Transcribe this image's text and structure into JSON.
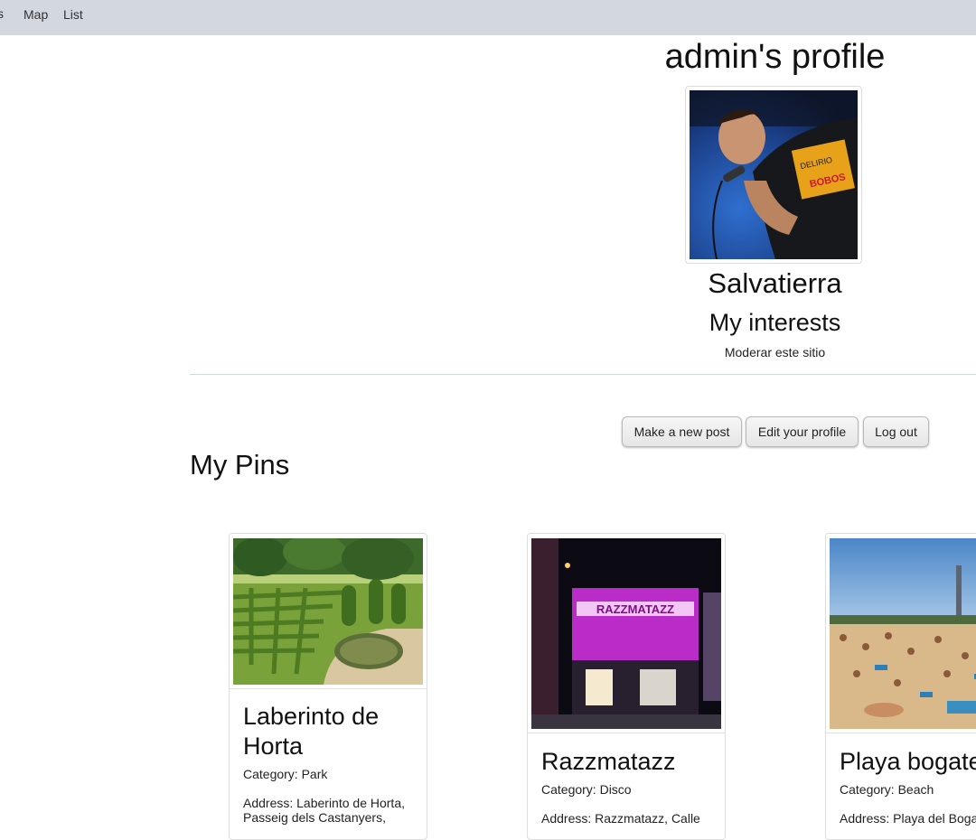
{
  "navbar": {
    "brand_fragment": "s",
    "links": [
      "Map",
      "List"
    ]
  },
  "profile": {
    "title": "admin's profile",
    "name": "Salvatierra",
    "interests_heading": "My interests",
    "interests_text": "Moderar este sitio"
  },
  "actions": {
    "new_post": "Make a new post",
    "edit_profile": "Edit your profile",
    "logout": "Log out"
  },
  "pins_heading": "My Pins",
  "pins": [
    {
      "title": "Laberinto de Horta",
      "category": "Category: Park",
      "address": "Address: Laberinto de Horta, Passeig dels Castanyers,"
    },
    {
      "title": "Razzmatazz",
      "category": "Category: Disco",
      "address": "Address: Razzmatazz, Calle",
      "image_sign": "RAZZMATAZZ"
    },
    {
      "title": "Playa bogatell",
      "category": "Category: Beach",
      "address": "Address: Playa del Bogatell"
    }
  ],
  "colors": {
    "navbar": "#d3d8df",
    "button_bg": "#ececec",
    "divider": "#cfe0dc"
  }
}
